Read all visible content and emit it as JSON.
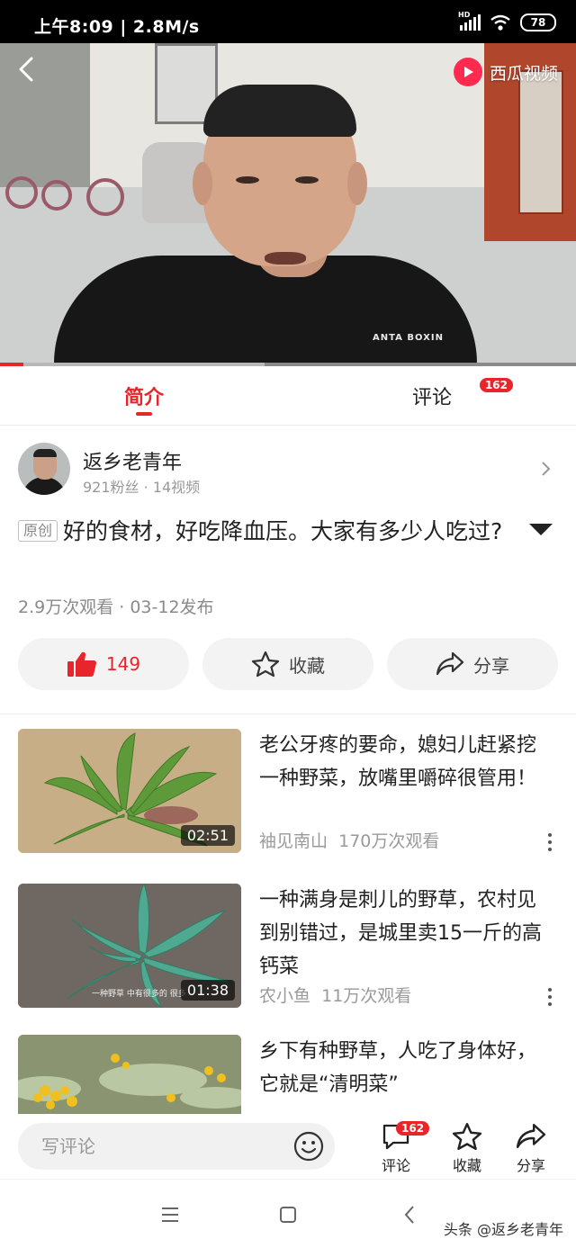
{
  "status_bar": {
    "time": "上午8:09 | 2.8M/s",
    "network": "HD",
    "battery": "78"
  },
  "video": {
    "brand": "西瓜视频",
    "shirt_text": "ANTA BOXIN",
    "played_fraction": 0.04,
    "buffered_fraction": 0.46
  },
  "tabs": [
    {
      "label": "简介",
      "active": true
    },
    {
      "label": "评论",
      "count": "162"
    }
  ],
  "author": {
    "name": "返乡老青年",
    "meta": "921粉丝 · 14视频"
  },
  "video_info": {
    "tag": "原创",
    "title": "好的食材，好吃降血压。大家有多少人吃过?",
    "stats": "2.9万次观看 · 03-12发布"
  },
  "actions": {
    "like_count": "149",
    "favorite": "收藏",
    "share": "分享"
  },
  "related": [
    {
      "title": "老公牙疼的要命，媳妇儿赶紧挖一种野菜，放嘴里嚼碎很管用！",
      "author": "袖见南山",
      "views": "170万次观看",
      "duration": "02:51"
    },
    {
      "title": "一种满身是刺儿的野草，农村见到别错过，是城里卖15一斤的高钙菜",
      "author": "农小鱼",
      "views": "11万次观看",
      "duration": "01:38",
      "caption": "一种野草 中有很多的 很多"
    },
    {
      "title": "乡下有种野草，人吃了身体好，它就是“清明菜”"
    }
  ],
  "bottom_bar": {
    "placeholder": "写评论",
    "comment_label": "评论",
    "comment_count": "162",
    "favorite_label": "收藏",
    "share_label": "分享"
  },
  "watermark": "头条 @返乡老青年",
  "colors": {
    "accent": "#e8252b",
    "brand": "#ff2b4f"
  }
}
